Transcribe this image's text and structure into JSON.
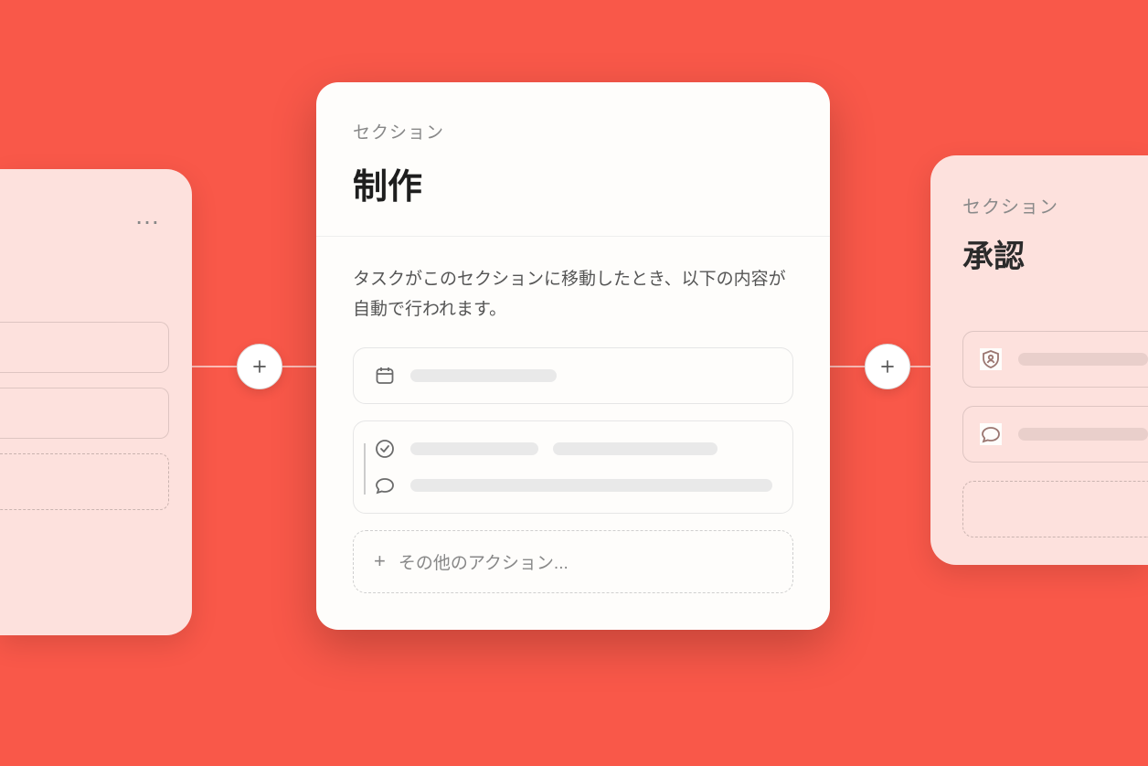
{
  "section_label": "セクション",
  "center": {
    "title": "制作",
    "description": "タスクがこのセクションに移動したとき、以下の内容が自動で行われます。",
    "more_actions": "その他のアクション..."
  },
  "right": {
    "title": "承認"
  },
  "icons": {
    "more": "…",
    "plus": "+"
  }
}
